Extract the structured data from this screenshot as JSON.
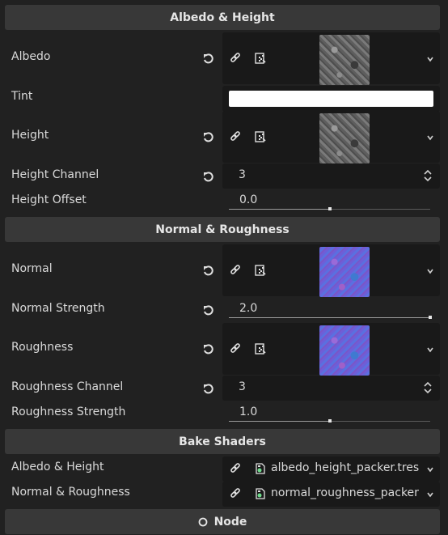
{
  "sections": {
    "albedo_height": "Albedo & Height",
    "normal_roughness": "Normal & Roughness",
    "bake_shaders": "Bake Shaders"
  },
  "properties": {
    "albedo": "Albedo",
    "tint": "Tint",
    "height": "Height",
    "height_channel": "Height Channel",
    "height_offset": "Height Offset",
    "normal": "Normal",
    "normal_strength": "Normal Strength",
    "roughness": "Roughness",
    "roughness_channel": "Roughness Channel",
    "roughness_strength": "Roughness Strength",
    "bake_albedo_height": "Albedo & Height",
    "bake_normal_roughness": "Normal & Roughness"
  },
  "values": {
    "tint_color": "#ffffff",
    "height_channel": "3",
    "height_offset": "0.0",
    "height_offset_fraction": 0.5,
    "normal_strength": "2.0",
    "normal_strength_fraction": 1.0,
    "roughness_channel": "3",
    "roughness_strength": "1.0",
    "roughness_strength_fraction": 0.5,
    "bake_albedo_height_file": "albedo_height_packer.tres",
    "bake_normal_roughness_file": "normal_roughness_packer"
  },
  "footer": {
    "node_button": "Node"
  },
  "icons": {
    "revert": "revert-icon",
    "link": "link-icon",
    "make_unique": "make-unique-icon",
    "chevron": "chevron-down-icon",
    "spin": "spin-arrows-icon",
    "resource": "resource-file-icon",
    "node": "node-circle-icon"
  },
  "colors": {
    "background": "#212121",
    "header": "#383838",
    "field": "#191919",
    "text": "#dadada"
  }
}
